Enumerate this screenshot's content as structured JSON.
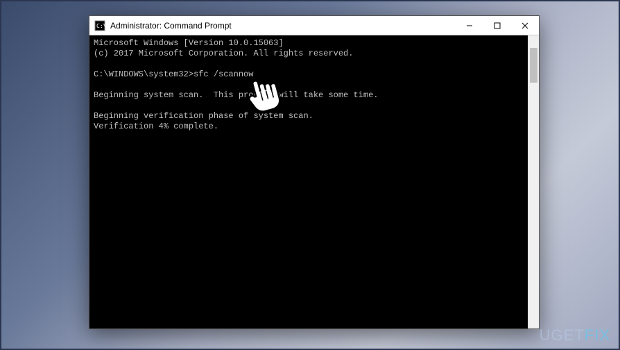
{
  "window": {
    "title": "Administrator: Command Prompt"
  },
  "terminal": {
    "line1": "Microsoft Windows [Version 10.0.15063]",
    "line2": "(c) 2017 Microsoft Corporation. All rights reserved.",
    "blank1": "",
    "prompt": "C:\\WINDOWS\\system32>",
    "command": "sfc /scannow",
    "blank2": "",
    "line3": "Beginning system scan.  This process will take some time.",
    "blank3": "",
    "line4": "Beginning verification phase of system scan.",
    "line5": "Verification 4% complete."
  },
  "watermark": {
    "part1": "UG",
    "part2": "E",
    "part3": "T",
    "part4": "FIX"
  }
}
